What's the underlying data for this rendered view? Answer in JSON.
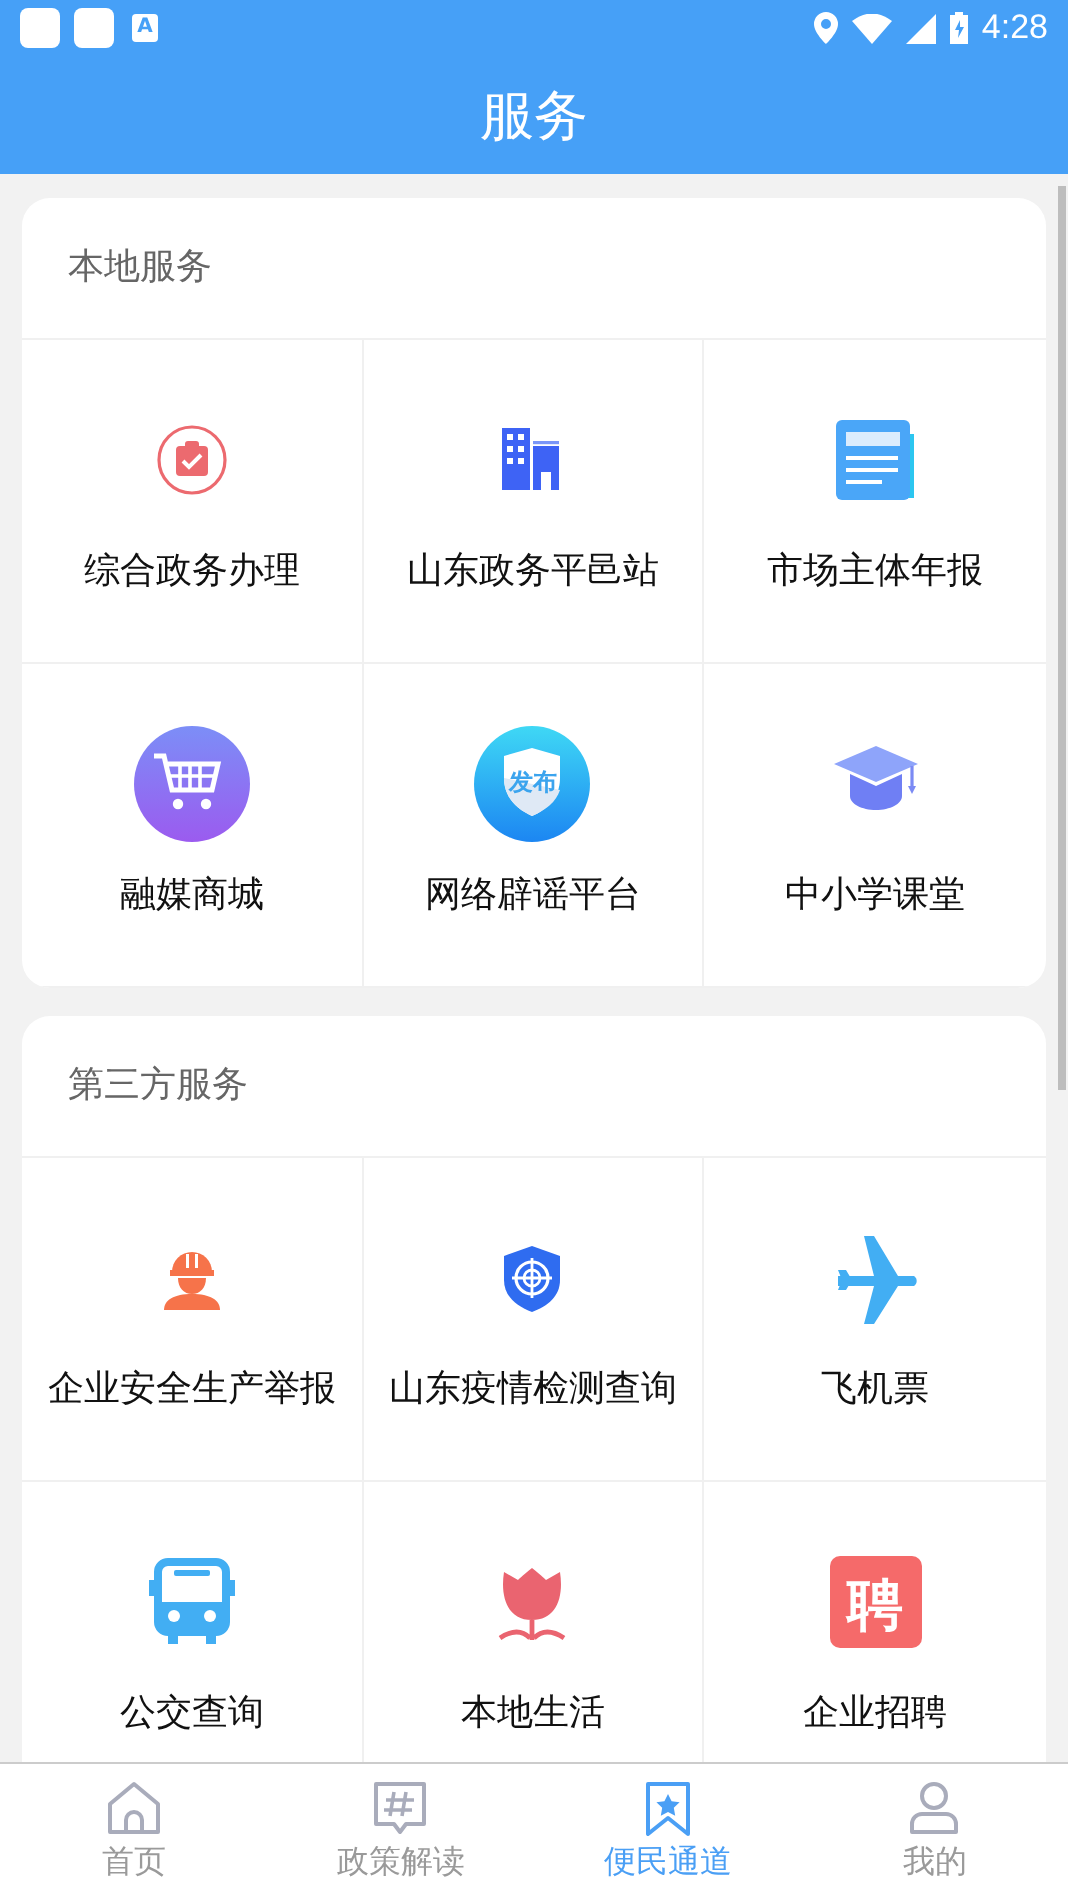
{
  "status_bar": {
    "notification_text": "A",
    "time": "4:28"
  },
  "header": {
    "title": "服务"
  },
  "sections": [
    {
      "title": "本地服务",
      "items": [
        {
          "label": "综合政务办理"
        },
        {
          "label": "山东政务平邑站"
        },
        {
          "label": "市场主体年报"
        },
        {
          "label": "融媒商城"
        },
        {
          "label": "网络辟谣平台",
          "icon_text": "发布"
        },
        {
          "label": "中小学课堂"
        }
      ]
    },
    {
      "title": "第三方服务",
      "items": [
        {
          "label": "企业安全生产举报"
        },
        {
          "label": "山东疫情检测查询"
        },
        {
          "label": "飞机票"
        },
        {
          "label": "公交查询"
        },
        {
          "label": "本地生活"
        },
        {
          "label": "企业招聘",
          "icon_text": "聘"
        }
      ]
    }
  ],
  "tab_bar": [
    {
      "label": "首页",
      "selected": false
    },
    {
      "label": "政策解读",
      "selected": false
    },
    {
      "label": "便民通道",
      "selected": true
    },
    {
      "label": "我的",
      "selected": false
    }
  ]
}
